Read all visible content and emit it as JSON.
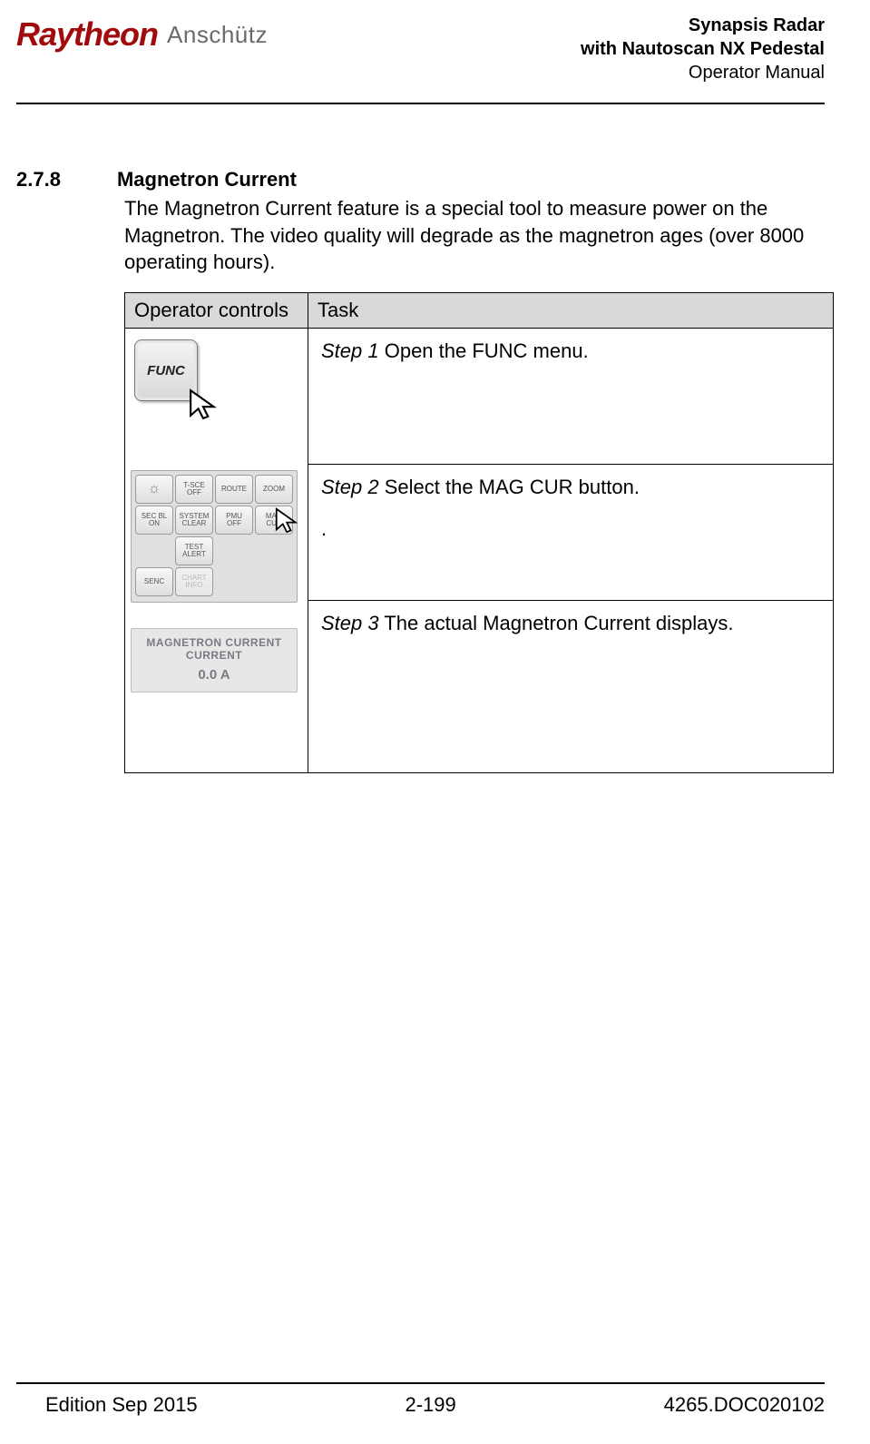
{
  "header": {
    "logo_brand": "Raytheon",
    "logo_sub": "Anschütz",
    "title1": "Synapsis Radar",
    "title2": "with Nautoscan NX Pedestal",
    "title3": "Operator Manual"
  },
  "section": {
    "number": "2.7.8",
    "title": "Magnetron Current",
    "body": "The Magnetron Current feature is a special tool to measure power on the Magnetron. The video quality will degrade as the magnetron ages (over 8000 operating hours)."
  },
  "table": {
    "col1": "Operator controls",
    "col2": "Task",
    "rows": [
      {
        "step_label": "Step 1",
        "step_text": " Open the FUNC menu.",
        "control": "func_button"
      },
      {
        "step_label": "Step 2",
        "step_text": " Select the MAG CUR button.",
        "step_extra": ".",
        "control": "panel"
      },
      {
        "step_label": "Step 3",
        "step_text": " The actual Magnetron Current displays.",
        "control": "readout"
      }
    ]
  },
  "func_button": {
    "label": "FUNC"
  },
  "panel": {
    "buttons_row1": [
      "☼",
      "T-SCE\nOFF",
      "ROUTE",
      "ZOOM"
    ],
    "buttons_row2": [
      "SEC BL\nON",
      "SYSTEM\nCLEAR",
      "PMU\nOFF",
      "MAG\nCUR"
    ],
    "buttons_row3": [
      "",
      "TEST\nALERT",
      "",
      ""
    ],
    "buttons_row4": [
      "SENC",
      "CHART\nINFO",
      "",
      ""
    ]
  },
  "readout": {
    "title1": "MAGNETRON CURRENT",
    "title2": "CURRENT",
    "value": "0.0 A"
  },
  "footer": {
    "edition": "Edition Sep 2015",
    "page": "2-199",
    "doc": "4265.DOC020102"
  }
}
